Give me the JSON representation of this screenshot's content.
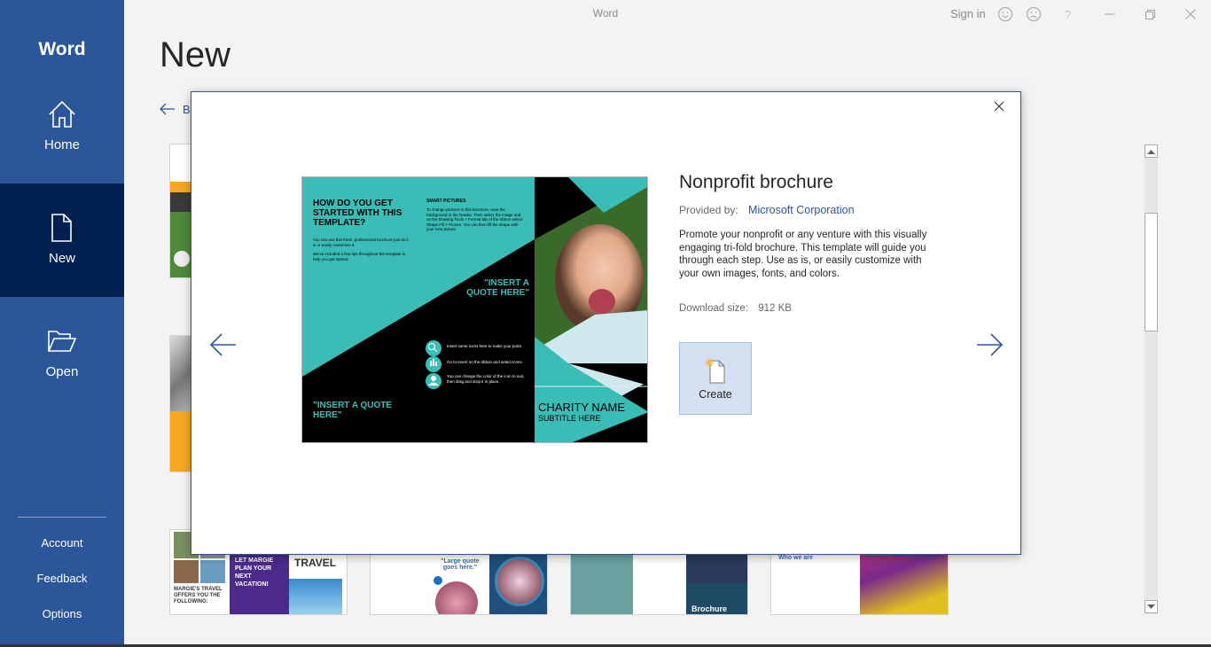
{
  "window": {
    "title": "Word",
    "sign_in": "Sign in"
  },
  "sidebar": {
    "app_name": "Word",
    "items": [
      {
        "label": "Home",
        "icon": "home-icon"
      },
      {
        "label": "New",
        "icon": "new-document-icon",
        "active": true
      },
      {
        "label": "Open",
        "icon": "folder-open-icon"
      }
    ],
    "footer": [
      {
        "label": "Account"
      },
      {
        "label": "Feedback"
      },
      {
        "label": "Options"
      }
    ]
  },
  "page": {
    "title": "New",
    "back_label": "Back"
  },
  "modal": {
    "template_title": "Nonprofit brochure",
    "provided_by_label": "Provided by:",
    "provider": "Microsoft Corporation",
    "description": "Promote your nonprofit or any venture with this visually engaging tri-fold brochure. This template will guide you through each step. Use as is, or easily customize with your own images, fonts, and colors.",
    "download_size_label": "Download size:",
    "download_size": "912 KB",
    "create_label": "Create",
    "preview": {
      "heading": "HOW DO YOU GET STARTED WITH THIS TEMPLATE?",
      "body1": "You can use this fresh, professional brochure just as it is or easily customize it.",
      "body2": "We've included a few tips throughout the template to help you get started.",
      "smart_title": "SMART PICTURES",
      "smart_body": "To change pictures in this brochure, view the background in the header. Then select the image and on the Drawing Tools > Format tab of the ribbon select Shape Fill > Picture. You can then fill the shape with your new picture.",
      "quote1": "\"INSERT A QUOTE HERE\"",
      "quote2": "\"INSERT A QUOTE HERE\"",
      "tip1": "Insert some icons here to make your point.",
      "tip2": "Go to Insert on the ribbon and select Icons.",
      "tip3": "You can change the color of the icon to suit, then drag and drop it in place.",
      "charity_name": "CHARITY NAME",
      "subtitle": "SUBTITLE HERE"
    }
  },
  "thumbnails": {
    "travel_title": "TRAVEL",
    "travel_plan": "LET MARGIE PLAN YOUR NEXT VACATION!",
    "travel_offers": "MARGIE'S TRAVEL OFFERS YOU THE FOLLOWING:",
    "large_quote": "\"Large quote goes here.\"",
    "brochure": "Brochure",
    "who_we_are": "Who we are"
  },
  "colors": {
    "brand": "#2b579a",
    "active_nav": "#002050",
    "teal": "#3bbdb7",
    "create_bg": "#d5e1f2"
  }
}
